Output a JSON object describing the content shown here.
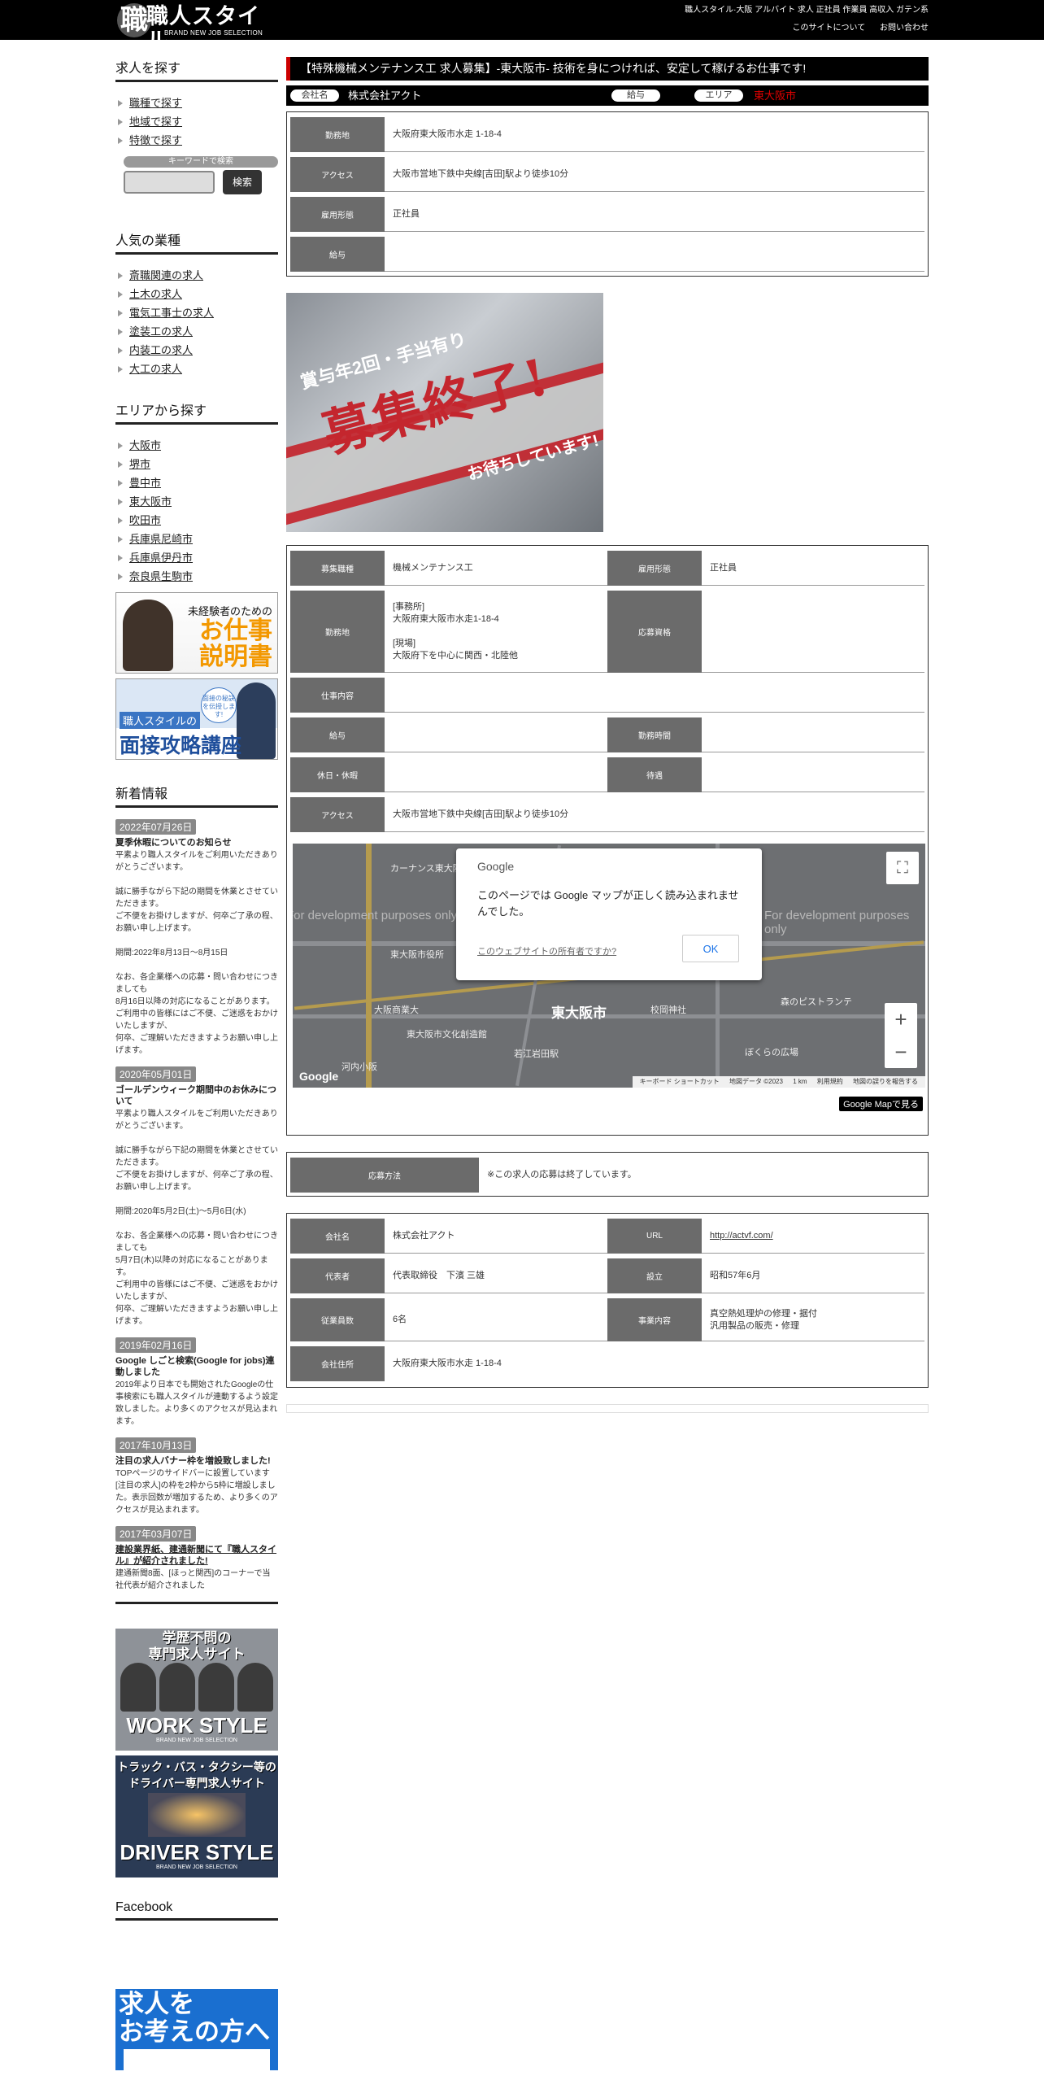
{
  "header": {
    "logo_mark": "職",
    "logo_title": "職人スタイル",
    "logo_sub": "BRAND NEW JOB SELECTION",
    "meta": "職人スタイル·大阪 アルバイト 求人 正社員 作業員 高収入 ガテン系",
    "links": [
      "このサイトについて",
      "お問い合わせ"
    ]
  },
  "sidebar": {
    "search_heading": "求人を探す",
    "search_links": [
      "職種で探す",
      "地域で探す",
      "特徴で探す"
    ],
    "keyword_label": "キーワードで検索",
    "search_button": "検索",
    "popular_heading": "人気の業種",
    "popular": [
      "斎職関連の求人",
      "土木の求人",
      "電気工事士の求人",
      "塗装工の求人",
      "内装工の求人",
      "大工の求人"
    ],
    "area_heading": "エリアから探す",
    "areas": [
      "大阪市",
      "堺市",
      "豊中市",
      "東大阪市",
      "吹田市",
      "兵庫県尼崎市",
      "兵庫県伊丹市",
      "奈良県生駒市"
    ],
    "banner1": {
      "line1": "未経験者のための",
      "line2": "お仕事",
      "line3": "説明書"
    },
    "banner2": {
      "bubble": "面接の秘訣を伝授します!",
      "line1": "職人スタイルの",
      "line2": "面接攻略講座"
    },
    "news_heading": "新着情報",
    "news": [
      {
        "date": "2022年07月26日",
        "title": "夏季休暇についてのお知らせ",
        "body": "平素より職人スタイルをご利用いただきありがとうございます。\n\n誠に勝手ながら下記の期間を休業とさせていただきます。\nご不便をお掛けしますが、何卒ご了承の程、お願い申し上げます。\n\n期間:2022年8月13日～8月15日\n\nなお、各企業様への応募・問い合わせにつきましても\n8月16日以降の対応になることがあります。\nご利用中の皆様にはご不便、ご迷惑をおかけいたしますが、\n何卒、ご理解いただきますようお願い申し上げます。"
      },
      {
        "date": "2020年05月01日",
        "title": "ゴールデンウィーク期間中のお休みについて",
        "body": "平素より職人スタイルをご利用いただきありがとうございます。\n\n誠に勝手ながら下記の期間を休業とさせていただきます。\nご不便をお掛けしますが、何卒ご了承の程、お願い申し上げます。\n\n期間:2020年5月2日(土)～5月6日(水)\n\nなお、各企業様への応募・問い合わせにつきましても\n5月7日(木)以降の対応になることがあります。\nご利用中の皆様にはご不便、ご迷惑をおかけいたしますが、\n何卒、ご理解いただきますようお願い申し上げます。"
      },
      {
        "date": "2019年02月16日",
        "title": "Google しごと検索(Google for jobs)連動しました",
        "body": "2019年より日本でも開始されたGoogleの仕事検索にも職人スタイルが連動するよう設定致しました。より多くのアクセスが見込まれます。"
      },
      {
        "date": "2017年10月13日",
        "title": "注目の求人バナー枠を増設致しました!",
        "body": "TOPページのサイドバーに設置しています[注目の求人]の枠を2枠から5枠に増設しました。表示回数が増加するため、より多くのアクセスが見込まれます。"
      },
      {
        "date": "2017年03月07日",
        "title": "建設業界紙、建通新聞にて『職人スタイル』が紹介されました!",
        "body": "建通新聞8面、[ほっと関西]のコーナーで当社代表が紹介されました"
      }
    ],
    "banner3": {
      "line1": "学歴不問の",
      "line2": "専門求人サイト",
      "big": "WORK STYLE",
      "sub": "BRAND NEW JOB SELECTION"
    },
    "banner4": {
      "line1": "トラック・バス・タクシー等の",
      "line2": "ドライバー専門求人サイト",
      "big": "DRIVER STYLE",
      "sub": "BRAND NEW JOB SELECTION"
    },
    "facebook_heading": "Facebook",
    "banner5": {
      "line1": "求人を",
      "line2": "お考えの方へ"
    }
  },
  "job": {
    "title": "【特殊機械メンテナンス工 求人募集】-東大阪市- 技術を身につければ、安定して稼げるお仕事です!",
    "company_label": "会社名",
    "company": "株式会社アクト",
    "salary_label": "給与",
    "area_label": "エリア",
    "area": "東大阪市",
    "accent": "#cc0000",
    "summary": [
      {
        "label": "勤務地",
        "value": "大阪府東大阪市水走 1-18-4"
      },
      {
        "label": "アクセス",
        "value": "大阪市営地下鉄中央線[吉田]駅より徒歩10分"
      },
      {
        "label": "雇用形態",
        "value": "正社員"
      },
      {
        "label": "給与",
        "value": ""
      }
    ],
    "image": {
      "headline": "賞与年2回・手当有り",
      "stamp": "募集終了!",
      "tail": "お待ちしています!"
    },
    "detail": {
      "type_label": "募集職種",
      "type": "機械メンテナンス工",
      "employ_label": "雇用形態",
      "employ": "正社員",
      "location_label": "勤務地",
      "location": "[事務所]\n大阪府東大阪市水走1-18-4\n\n[現場]\n大阪府下を中心に関西・北陸他",
      "qual_label": "応募資格",
      "qual": "",
      "work_label": "仕事内容",
      "work": "",
      "salary_label": "給与",
      "salary": "",
      "hours_label": "勤務時間",
      "hours": "",
      "holiday_label": "休日・休暇",
      "holiday": "",
      "benefit_label": "待遇",
      "benefit": "",
      "access_label": "アクセス",
      "access": "大阪市営地下鉄中央線[吉田]駅より徒歩10分"
    },
    "map": {
      "dev_text": "For development purposes only",
      "city": "東大阪市",
      "places": [
        "カーナンス東大阪店",
        "東大阪市役所",
        "大阪商業大",
        "東大阪市文化創造館",
        "校岡神社",
        "森のピストランテ",
        "ぼくらの広場",
        "若江岩田駅",
        "河内小阪"
      ],
      "dialog_brand": "Google",
      "dialog_message": "このページでは Google マップが正しく読み込まれませんでした。",
      "dialog_question": "このウェブサイトの所有者ですか?",
      "dialog_ok": "OK",
      "logo": "Google",
      "attribution": [
        "キーボード ショートカット",
        "地図データ ©2023",
        "1 km",
        "利用規約",
        "地図の誤りを報告する"
      ],
      "zoom_in": "+",
      "zoom_out": "−",
      "fullscreen": "⛶",
      "open_button": "Google Mapで見る"
    },
    "apply_label": "応募方法",
    "apply_text": "※この求人の応募は終了しています。",
    "company_info": {
      "name_label": "会社名",
      "name": "株式会社アクト",
      "url_label": "URL",
      "url": "http://actvf.com/",
      "rep_label": "代表者",
      "rep": "代表取締役　下濱 三雄",
      "est_label": "設立",
      "est": "昭和57年6月",
      "staff_label": "従業員数",
      "staff": "6名",
      "biz_label": "事業内容",
      "biz": "真空熱処理炉の修理・据付\n汎用製品の販売・修理",
      "addr_label": "会社住所",
      "addr": "大阪府東大阪市水走 1-18-4"
    }
  }
}
